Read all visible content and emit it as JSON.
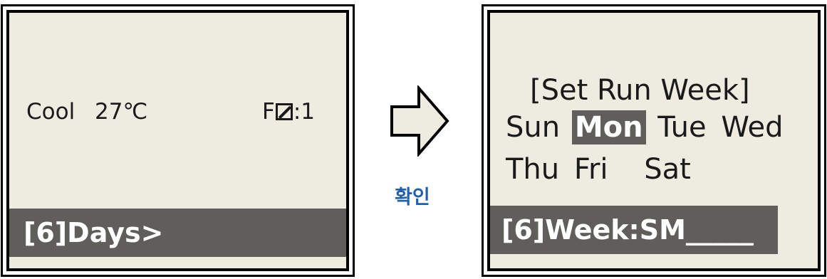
{
  "left_screen": {
    "mode": "Cool",
    "temperature": "27℃",
    "fan_prefix": "F",
    "fan_value": ":1",
    "footer": "[6]Days>"
  },
  "transition": {
    "label": "확인",
    "arrow_fill": "#eeece1",
    "label_color": "#1f5fb0"
  },
  "right_screen": {
    "title": "[Set Run Week]",
    "days_row1": [
      "Sun",
      "Mon",
      "Tue",
      "Wed"
    ],
    "days_row2": [
      "Thu",
      "Fri",
      "Sat"
    ],
    "selected_day": "Mon",
    "footer": "[6]Week:SM_____"
  },
  "colors": {
    "lcd_background": "#eeece1",
    "highlight_bar": "#605e5b"
  }
}
